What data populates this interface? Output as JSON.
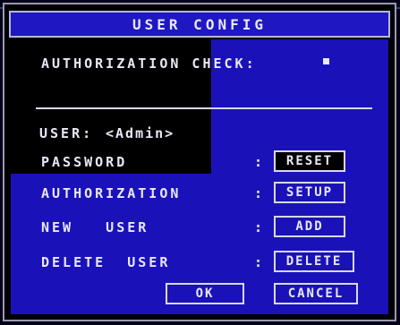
{
  "title": "USER CONFIG",
  "authorization_check": {
    "label": "AUTHORIZATION CHECK:"
  },
  "user": {
    "label": "USER:",
    "value": "<Admin>"
  },
  "rows": [
    {
      "label": "PASSWORD",
      "colon": ":",
      "button": "RESET"
    },
    {
      "label": "AUTHORIZATION",
      "colon": ":",
      "button": "SETUP"
    },
    {
      "label": "NEW   USER",
      "colon": ":",
      "button": "ADD"
    },
    {
      "label": "DELETE  USER",
      "colon": ":",
      "button": "DELETE"
    }
  ],
  "footer": {
    "ok": "OK",
    "cancel": "CANCEL"
  }
}
